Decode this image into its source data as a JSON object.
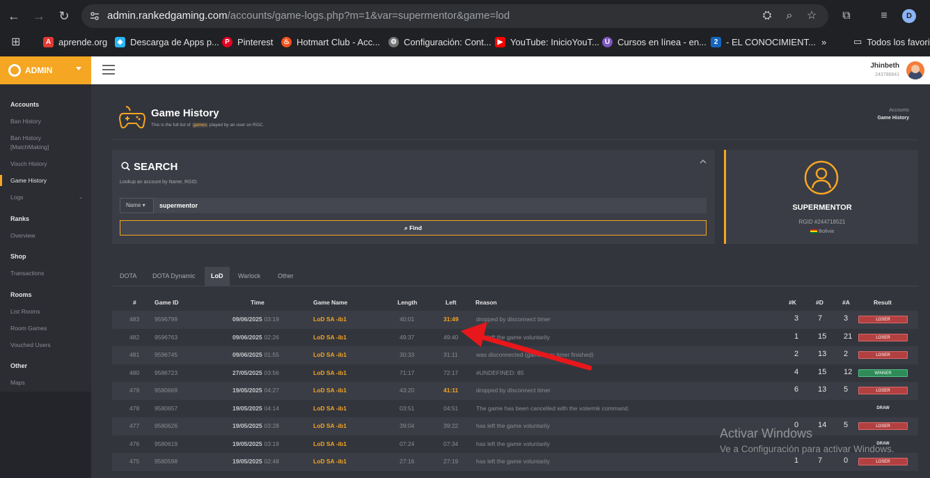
{
  "browser": {
    "url_host": "admin.rankedgaming.com",
    "url_path": "/accounts/game-logs.php?m=1&var=supermentor&game=lod",
    "profile_initial": "D",
    "bookmarks": [
      {
        "label": "aprende.org",
        "color": "#e53935",
        "glyph": "A"
      },
      {
        "label": "Descarga de Apps p...",
        "color": "#29b6f6",
        "glyph": "◆"
      },
      {
        "label": "Pinterest",
        "color": "#e60023",
        "glyph": "P"
      },
      {
        "label": "Hotmart Club - Acc...",
        "color": "#f4511e",
        "glyph": "♨"
      },
      {
        "label": "Configuración: Cont...",
        "color": "#757575",
        "glyph": "⚙"
      },
      {
        "label": "YouTube: InicioYouT...",
        "color": "#ff0000",
        "glyph": "▶"
      },
      {
        "label": "Cursos en línea - en...",
        "color": "#7e57c2",
        "glyph": "U"
      },
      {
        "label": "- EL CONOCIMIENT...",
        "color": "#1565c0",
        "glyph": "2"
      }
    ],
    "all_bookmarks": "Todos los favoritos"
  },
  "topbar": {
    "brand": "ADMIN",
    "user_name": "Jhinbeth",
    "user_id": "243786841"
  },
  "sidebar": {
    "sections": [
      {
        "title": "Accounts",
        "items": [
          "Ban History",
          "Ban History [MatchMaking]",
          "Vouch History",
          "Game History",
          "Logs"
        ]
      },
      {
        "title": "Ranks",
        "items": [
          "Overview"
        ]
      },
      {
        "title": "Shop",
        "items": [
          "Transactions"
        ]
      },
      {
        "title": "Rooms",
        "items": [
          "List Rooms",
          "Room Games",
          "Vouched Users"
        ]
      },
      {
        "title": "Other",
        "items": [
          "Maps"
        ]
      }
    ]
  },
  "page": {
    "title": "Game History",
    "subtitle_pre": "This is the full list of",
    "subtitle_tag": "games",
    "subtitle_post": "played by an user on RGC.",
    "breadcrumb_1": "Accounts",
    "breadcrumb_2": "Game History"
  },
  "search": {
    "title": "SEARCH",
    "hint": "Lookup an account by Name, RGID.",
    "select_label": "Name",
    "value": "supermentor",
    "find_label": "Find"
  },
  "profile": {
    "name": "SUPERMENTOR",
    "rgid": "RGID #244718521",
    "country": "Bolivia"
  },
  "tabs": [
    "DOTA",
    "DOTA Dynamic",
    "LoD",
    "Warlock",
    "Other"
  ],
  "table": {
    "headers": [
      "#",
      "Game ID",
      "Time",
      "Game Name",
      "Length",
      "Left",
      "Reason",
      "#K",
      "#D",
      "#A",
      "Result"
    ],
    "rows": [
      {
        "n": "483",
        "id": "9596799",
        "date": "09/06/2025",
        "time": "03:19",
        "game": "LoD SA -ib1",
        "length": "40:01",
        "left": "31:49",
        "left_hl": true,
        "reason": "dropped by disconnect timer",
        "k": "3",
        "d": "7",
        "a": "3",
        "result": "LOSER"
      },
      {
        "n": "482",
        "id": "9596763",
        "date": "09/06/2025",
        "time": "02:26",
        "game": "LoD SA -ib1",
        "length": "49:37",
        "left": "49:40",
        "left_hl": false,
        "reason": "has left the game voluntarily",
        "k": "1",
        "d": "15",
        "a": "21",
        "result": "LOSER"
      },
      {
        "n": "481",
        "id": "9596745",
        "date": "09/06/2025",
        "time": "01:55",
        "game": "LoD SA -ib1",
        "length": "30:33",
        "left": "31:11",
        "left_hl": false,
        "reason": "was disconnected (game over timer finished)",
        "k": "2",
        "d": "13",
        "a": "2",
        "result": "LOSER"
      },
      {
        "n": "480",
        "id": "9586723",
        "date": "27/05/2025",
        "time": "03:56",
        "game": "LoD SA -ib1",
        "length": "71:17",
        "left": "72:17",
        "left_hl": false,
        "reason": "#UNDEFINED: 85",
        "k": "4",
        "d": "15",
        "a": "12",
        "result": "WINNER"
      },
      {
        "n": "479",
        "id": "9580669",
        "date": "19/05/2025",
        "time": "04:27",
        "game": "LoD SA -ib1",
        "length": "43:20",
        "left": "41:11",
        "left_hl": true,
        "reason": "dropped by disconnect timer",
        "k": "6",
        "d": "13",
        "a": "5",
        "result": "LOSER"
      },
      {
        "n": "478",
        "id": "9580657",
        "date": "19/05/2025",
        "time": "04:14",
        "game": "LoD SA -ib1",
        "length": "03:51",
        "left": "04:51",
        "left_hl": false,
        "reason": "The game has been cancelled with the votermk command.",
        "k": "",
        "d": "",
        "a": "",
        "result": "DRAW"
      },
      {
        "n": "477",
        "id": "9580626",
        "date": "19/05/2025",
        "time": "03:28",
        "game": "LoD SA -ib1",
        "length": "39:04",
        "left": "39:22",
        "left_hl": false,
        "reason": "has left the game voluntarily",
        "k": "0",
        "d": "14",
        "a": "5",
        "result": "LOSER"
      },
      {
        "n": "476",
        "id": "9580619",
        "date": "19/05/2025",
        "time": "03:19",
        "game": "LoD SA -ib1",
        "length": "07:24",
        "left": "07:34",
        "left_hl": false,
        "reason": "has left the game voluntarily",
        "k": "",
        "d": "",
        "a": "",
        "result": "DRAW"
      },
      {
        "n": "475",
        "id": "9580598",
        "date": "19/05/2025",
        "time": "02:48",
        "game": "LoD SA -ib1",
        "length": "27:16",
        "left": "27:19",
        "left_hl": false,
        "reason": "has left the game voluntarily",
        "k": "1",
        "d": "7",
        "a": "0",
        "result": "LOSER"
      }
    ]
  },
  "watermark": {
    "line1": "Activar Windows",
    "line2": "Ve a Configuración para activar Windows."
  }
}
